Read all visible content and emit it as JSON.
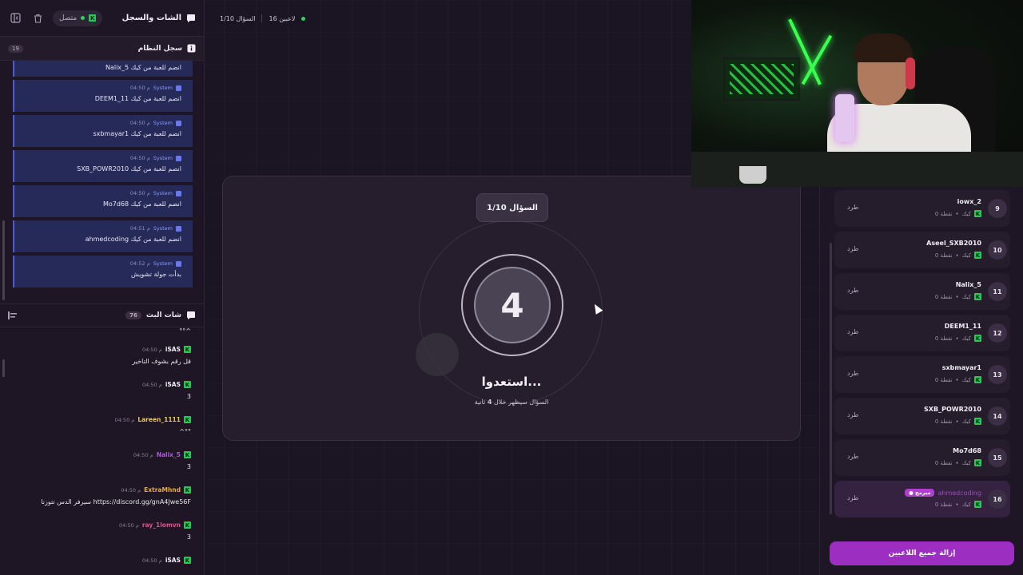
{
  "left": {
    "title": "الشات والسجل",
    "status": "متصل",
    "system_log": {
      "title": "سجل النظام",
      "count": "19",
      "first_msg": "Nalix_5 انضم للعبة من كيك",
      "items": [
        {
          "sender": "System",
          "time": "04:50 م",
          "msg": "DEEM1_11 انضم للعبة من كيك"
        },
        {
          "sender": "System",
          "time": "04:50 م",
          "msg": "sxbmayar1 انضم للعبة من كيك"
        },
        {
          "sender": "System",
          "time": "04:50 م",
          "msg": "SXB_POWR2010 انضم للعبة من كيك"
        },
        {
          "sender": "System",
          "time": "04:50 م",
          "msg": "Mo7d68 انضم للعبة من كيك"
        },
        {
          "sender": "System",
          "time": "04:51 م",
          "msg": "ahmedcoding انضم للعبة من كيك"
        },
        {
          "sender": "System",
          "time": "04:52 م",
          "msg": "بدأت جولة تشويش"
        }
      ]
    },
    "stream_chat": {
      "title": "شات البث",
      "count": "76",
      "first_msg": "°°^",
      "items": [
        {
          "user": "iSAS",
          "color": "#f1ecf5",
          "time": "04:50 م",
          "msg": "قل رقم بشوف التاخير"
        },
        {
          "user": "iSAS",
          "color": "#f1ecf5",
          "time": "04:50 م",
          "msg": "3"
        },
        {
          "user": "Lareen_1111",
          "color": "#e8c84a",
          "time": "04:50 م",
          "msg": "^°°"
        },
        {
          "user": "Nalix_5",
          "color": "#a85ad8",
          "time": "04:50 م",
          "msg": "3"
        },
        {
          "user": "ExtraMhnd",
          "color": "#e8a84a",
          "time": "04:50 م",
          "msg": "سيرفر الدس تتوزنا https://discord.gg/gnA4Jwe56F"
        },
        {
          "user": "ray_1lomvn",
          "color": "#e0508a",
          "time": "04:50 م",
          "msg": "3"
        },
        {
          "user": "iSAS",
          "color": "#f1ecf5",
          "time": "04:50 م",
          "msg": ""
        }
      ]
    }
  },
  "top": {
    "players": "16 لاعبين",
    "question": "السؤال 1/10"
  },
  "main": {
    "question_label": "السؤال 1/10",
    "countdown": "4",
    "ready": "استعدوا...",
    "sub_pre": "السؤال سيظهر خلال ",
    "sub_num": "4",
    "sub_post": " ثانية"
  },
  "players": [
    {
      "num": "9",
      "name": "iowx_2",
      "platform": "كيك",
      "points": "0 نقطة",
      "kick": "طرد"
    },
    {
      "num": "10",
      "name": "Aseel_SXB2010",
      "platform": "كيك",
      "points": "0 نقطة",
      "kick": "طرد"
    },
    {
      "num": "11",
      "name": "Nalix_5",
      "platform": "كيك",
      "points": "0 نقطة",
      "kick": "طرد"
    },
    {
      "num": "12",
      "name": "DEEM1_11",
      "platform": "كيك",
      "points": "0 نقطة",
      "kick": "طرد"
    },
    {
      "num": "13",
      "name": "sxbmayar1",
      "platform": "كيك",
      "points": "0 نقطة",
      "kick": "طرد"
    },
    {
      "num": "14",
      "name": "SXB_POWR2010",
      "platform": "كيك",
      "points": "0 نقطة",
      "kick": "طرد"
    },
    {
      "num": "15",
      "name": "Mo7d68",
      "platform": "كيك",
      "points": "0 نقطة",
      "kick": "طرد"
    },
    {
      "num": "16",
      "name": "ahmedcoding",
      "platform": "كيك",
      "points": "0 نقطة",
      "kick": "طرد",
      "badge": "مبرمج"
    }
  ],
  "remove_all": "إزالة جميع اللاعبين"
}
